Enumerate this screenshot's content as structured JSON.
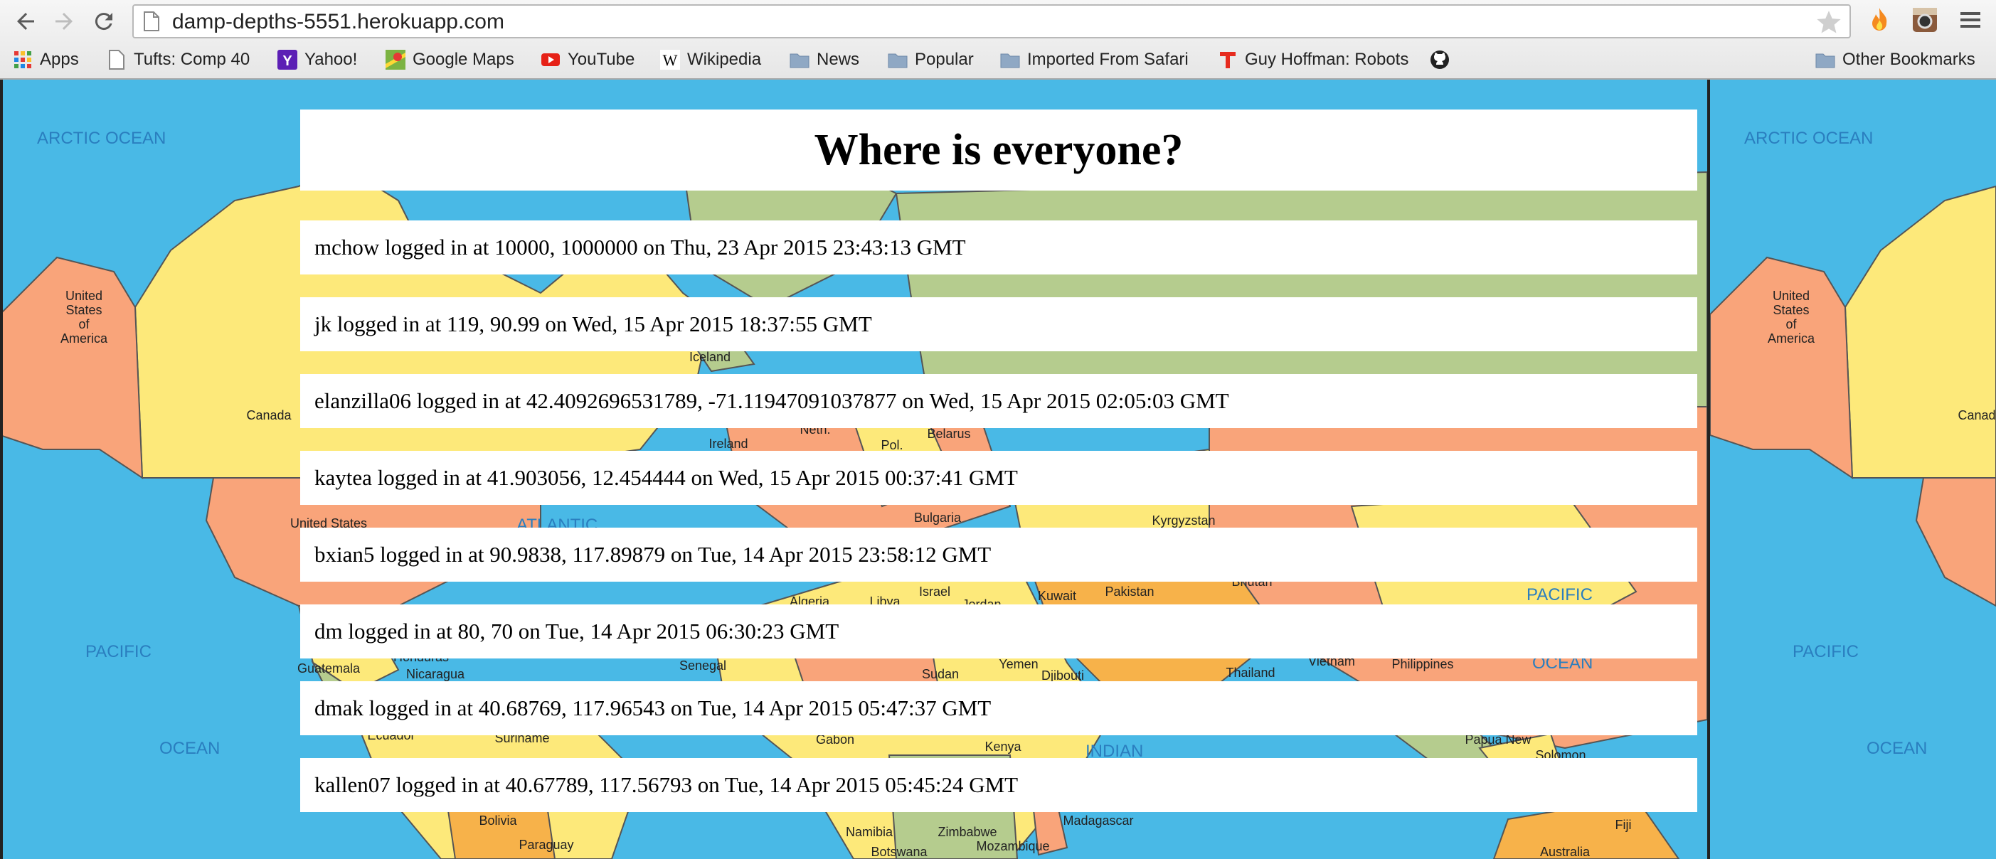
{
  "browser": {
    "url": "damp-depths-5551.herokuapp.com",
    "bookmarks": [
      {
        "label": "Apps",
        "icon": "apps-grid-icon"
      },
      {
        "label": "Tufts: Comp 40",
        "icon": "page-icon"
      },
      {
        "label": "Yahoo!",
        "icon": "yahoo-icon"
      },
      {
        "label": "Google Maps",
        "icon": "google-maps-icon"
      },
      {
        "label": "YouTube",
        "icon": "youtube-icon"
      },
      {
        "label": "Wikipedia",
        "icon": "wikipedia-icon"
      },
      {
        "label": "News",
        "icon": "folder-icon"
      },
      {
        "label": "Popular",
        "icon": "folder-icon"
      },
      {
        "label": "Imported From Safari",
        "icon": "folder-icon"
      },
      {
        "label": "Guy Hoffman: Robots",
        "icon": "ted-icon"
      },
      {
        "label": "",
        "icon": "github-icon"
      }
    ],
    "other_bookmarks": "Other Bookmarks"
  },
  "map_labels": {
    "arctic": "ARCTIC OCEAN",
    "pacific": "PACIFIC",
    "ocean": "OCEAN",
    "atlantic": "ATLANTIC",
    "indian": "INDIAN",
    "usa": [
      "United",
      "States",
      "of",
      "America"
    ],
    "canada": "Canada",
    "iceland": "Iceland",
    "ireland": "Ireland",
    "belarus": "Belarus",
    "pol": "Pol.",
    "neth": "Neth.",
    "bulgaria": "Bulgaria",
    "kyrgyzstan": "Kyrgyzstan",
    "israel": "Israel",
    "jordan": "Jordan",
    "kuwait": "Kuwait",
    "pakistan": "Pakistan",
    "bhutan": "Bhutan",
    "algeria": "Algeria",
    "libya": "Libya",
    "sudan": "Sudan",
    "yemen": "Yemen",
    "djibouti": "Djibouti",
    "senegal": "Senegal",
    "honduras": "Honduras",
    "nicaragua": "Nicaragua",
    "guatemala": "Guatemala",
    "ecuador": "Ecuador",
    "suriname": "Suriname",
    "gabon": "Gabon",
    "kenya": "Kenya",
    "thailand": "Thailand",
    "vietnam": "Vietnam",
    "philippines": "Philippines",
    "papua": "Papua New",
    "bolivia": "Bolivia",
    "paraguay": "Paraguay",
    "namibia": "Namibia",
    "zimbabwe": "Zimbabwe",
    "mozambique": "Mozambique",
    "madagascar": "Madagascar",
    "botswana": "Botswana",
    "fiji": "Fiji",
    "australia": "Australia",
    "us_label": "United States",
    "solomon": "Solomon"
  },
  "page": {
    "title": "Where is everyone?",
    "entries": [
      "mchow logged in at 10000, 1000000 on Thu, 23 Apr 2015 23:43:13 GMT",
      "jk logged in at 119, 90.99 on Wed, 15 Apr 2015 18:37:55 GMT",
      "elanzilla06 logged in at 42.4092696531789, -71.11947091037877 on Wed, 15 Apr 2015 02:05:03 GMT",
      "kaytea logged in at 41.903056, 12.454444 on Wed, 15 Apr 2015 00:37:41 GMT",
      "bxian5 logged in at 90.9838, 117.89879 on Tue, 14 Apr 2015 23:58:12 GMT",
      "dm logged in at 80, 70 on Tue, 14 Apr 2015 06:30:23 GMT",
      "dmak logged in at 40.68769, 117.96543 on Tue, 14 Apr 2015 05:47:37 GMT",
      "kallen07 logged in at 40.67789, 117.56793 on Tue, 14 Apr 2015 05:45:24 GMT"
    ]
  },
  "colors": {
    "ocean": "#49b9e6",
    "land_yellow": "#fde97a",
    "land_salmon": "#f9a47a",
    "land_green": "#b5cc8e",
    "land_orange": "#f7b24a"
  }
}
